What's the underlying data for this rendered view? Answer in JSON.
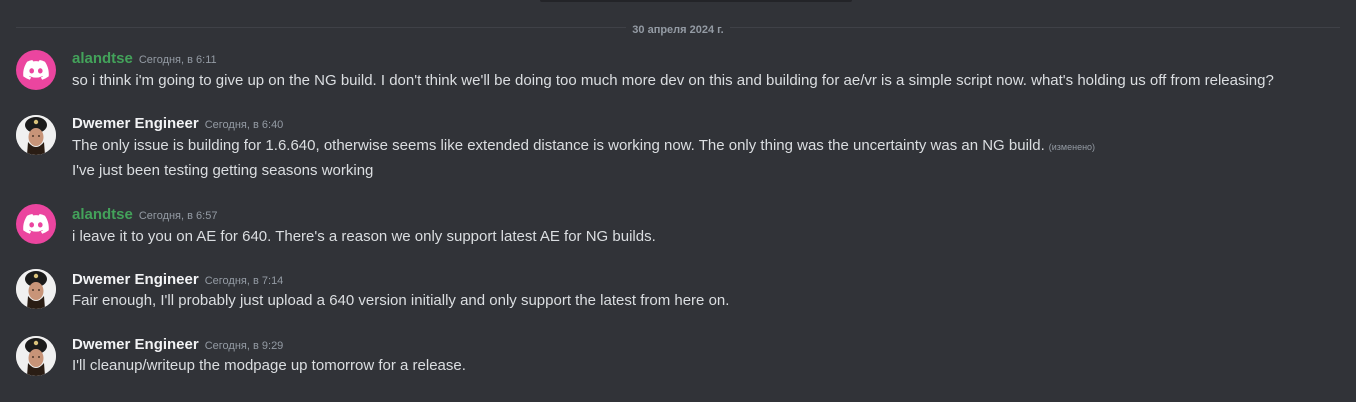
{
  "date_divider": "30 апреля 2024 г.",
  "colors": {
    "background": "#313338",
    "alandtse_name": "#43a25a",
    "dwemer_name": "#f2f3f5",
    "discord_avatar": "#eb459f",
    "message_text": "#dbdee1",
    "meta_text": "#949ba4"
  },
  "messages": [
    {
      "author": "alandtse",
      "timestamp": "Сегодня, в 6:11",
      "avatar": "discord-logo-icon",
      "lines": [
        "so i think i'm going to give up on the NG build. I don't think we'll be doing too much more dev on this and building for ae/vr is a simple script now. what's holding us off from releasing?"
      ]
    },
    {
      "author": "Dwemer Engineer",
      "timestamp": "Сегодня, в 6:40",
      "avatar": "user-photo-icon",
      "lines": [
        "The only issue is building for 1.6.640, otherwise seems like extended distance is working now. The only thing was the uncertainty was an NG build.",
        "I've just been testing getting seasons working"
      ],
      "edited_label": "(изменено)"
    },
    {
      "author": "alandtse",
      "timestamp": "Сегодня, в 6:57",
      "avatar": "discord-logo-icon",
      "lines": [
        "i leave it to you on AE for 640. There's a reason we only support latest AE for NG builds."
      ]
    },
    {
      "author": "Dwemer Engineer",
      "timestamp": "Сегодня, в 7:14",
      "avatar": "user-photo-icon",
      "lines": [
        "Fair enough, I'll probably just upload a 640 version initially and only support the latest from here on."
      ]
    },
    {
      "author": "Dwemer Engineer",
      "timestamp": "Сегодня, в 9:29",
      "avatar": "user-photo-icon",
      "lines": [
        "I'll cleanup/writeup the modpage up tomorrow for a release."
      ]
    }
  ]
}
